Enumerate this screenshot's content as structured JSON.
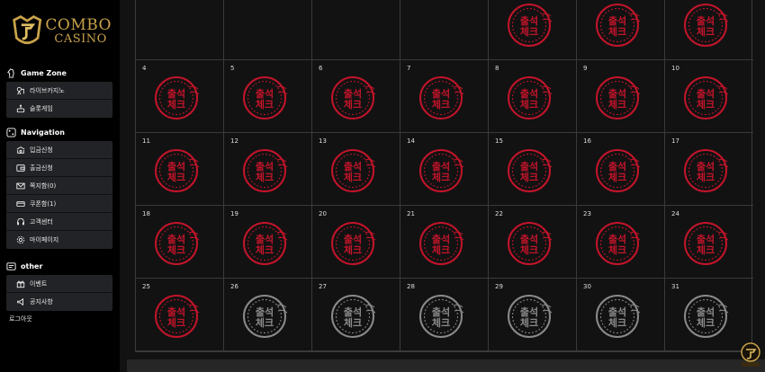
{
  "brand": {
    "line1": "COMBO",
    "line2": "CASINO",
    "badge_text": ""
  },
  "sections": {
    "game_zone": {
      "title": "Game Zone",
      "items": [
        {
          "label": "라이브카지노",
          "icon": "live-casino-icon"
        },
        {
          "label": "슬롯게임",
          "icon": "slot-game-icon"
        }
      ]
    },
    "navigation": {
      "title": "Navigation",
      "items": [
        {
          "label": "입금신청",
          "icon": "deposit-icon"
        },
        {
          "label": "출금신청",
          "icon": "withdraw-icon"
        },
        {
          "label": "쪽지함(0)",
          "icon": "mail-icon"
        },
        {
          "label": "쿠폰함(1)",
          "icon": "coupon-icon"
        },
        {
          "label": "고객센터",
          "icon": "headset-icon"
        },
        {
          "label": "마이페이지",
          "icon": "settings-icon"
        }
      ]
    },
    "other": {
      "title": "other",
      "items": [
        {
          "label": "이벤트",
          "icon": "gift-icon"
        },
        {
          "label": "공지사항",
          "icon": "notice-icon"
        }
      ],
      "logout": "로그아웃"
    }
  },
  "calendar": {
    "stamp_text_top": "출석",
    "stamp_text_bottom": "체크",
    "stamp_active_color": "#c3142a",
    "stamp_inactive_color": "#8a8a8a",
    "days": [
      {
        "day": "",
        "stamp": "none"
      },
      {
        "day": "",
        "stamp": "none"
      },
      {
        "day": "",
        "stamp": "none"
      },
      {
        "day": "",
        "stamp": "none"
      },
      {
        "day": "",
        "stamp": "active"
      },
      {
        "day": "",
        "stamp": "active"
      },
      {
        "day": "",
        "stamp": "active"
      },
      {
        "day": "4",
        "stamp": "active"
      },
      {
        "day": "5",
        "stamp": "active"
      },
      {
        "day": "6",
        "stamp": "active"
      },
      {
        "day": "7",
        "stamp": "active"
      },
      {
        "day": "8",
        "stamp": "active"
      },
      {
        "day": "9",
        "stamp": "active"
      },
      {
        "day": "10",
        "stamp": "active"
      },
      {
        "day": "11",
        "stamp": "active"
      },
      {
        "day": "12",
        "stamp": "active"
      },
      {
        "day": "13",
        "stamp": "active"
      },
      {
        "day": "14",
        "stamp": "active"
      },
      {
        "day": "15",
        "stamp": "active"
      },
      {
        "day": "16",
        "stamp": "active"
      },
      {
        "day": "17",
        "stamp": "active"
      },
      {
        "day": "18",
        "stamp": "active"
      },
      {
        "day": "19",
        "stamp": "active"
      },
      {
        "day": "20",
        "stamp": "active"
      },
      {
        "day": "21",
        "stamp": "active"
      },
      {
        "day": "22",
        "stamp": "active"
      },
      {
        "day": "23",
        "stamp": "active"
      },
      {
        "day": "24",
        "stamp": "active"
      },
      {
        "day": "25",
        "stamp": "active"
      },
      {
        "day": "26",
        "stamp": "inactive"
      },
      {
        "day": "27",
        "stamp": "inactive"
      },
      {
        "day": "28",
        "stamp": "inactive"
      },
      {
        "day": "29",
        "stamp": "inactive"
      },
      {
        "day": "30",
        "stamp": "inactive"
      },
      {
        "day": "31",
        "stamp": "inactive"
      }
    ]
  },
  "colors": {
    "accent_gold": "#c9a24a",
    "background": "#121212",
    "sidebar": "#000000",
    "menu_bg": "#222326"
  }
}
